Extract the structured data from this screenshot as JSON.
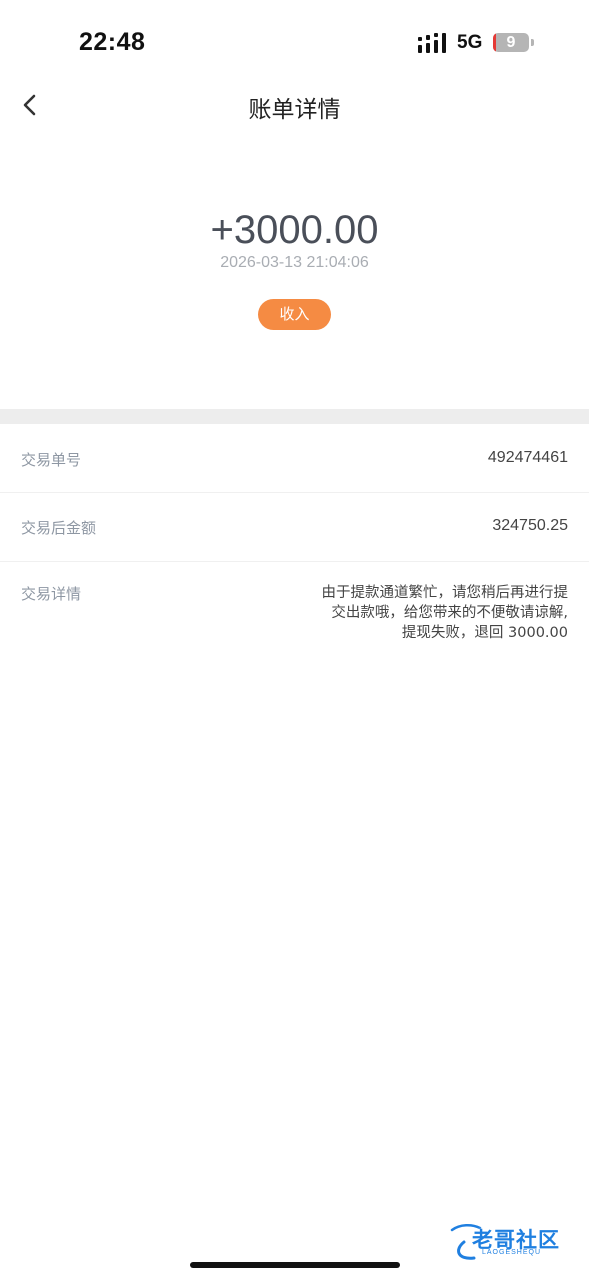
{
  "status_bar": {
    "time": "22:48",
    "network": "5G",
    "battery_level": "9",
    "battery_fraction": 0.09
  },
  "nav": {
    "back_icon": "chevron-left-icon",
    "title": "账单详情"
  },
  "summary": {
    "amount": "+3000.00",
    "datetime": "2026-03-13 21:04:06",
    "type_badge": "收入",
    "badge_color": "#f58b43"
  },
  "details": {
    "order_no_label": "交易单号",
    "order_no_value": "492474461",
    "balance_label": "交易后金额",
    "balance_value": "324750.25",
    "detail_label": "交易详情",
    "detail_lines": [
      "由于提款通道繁忙，请您稍后再进行提",
      "交出款哦，给您带来的不便敬请谅解,",
      "提现失败，退回 3000.00"
    ]
  },
  "watermark": {
    "text": "老哥社区",
    "sub": "LAOGESHEQU"
  }
}
